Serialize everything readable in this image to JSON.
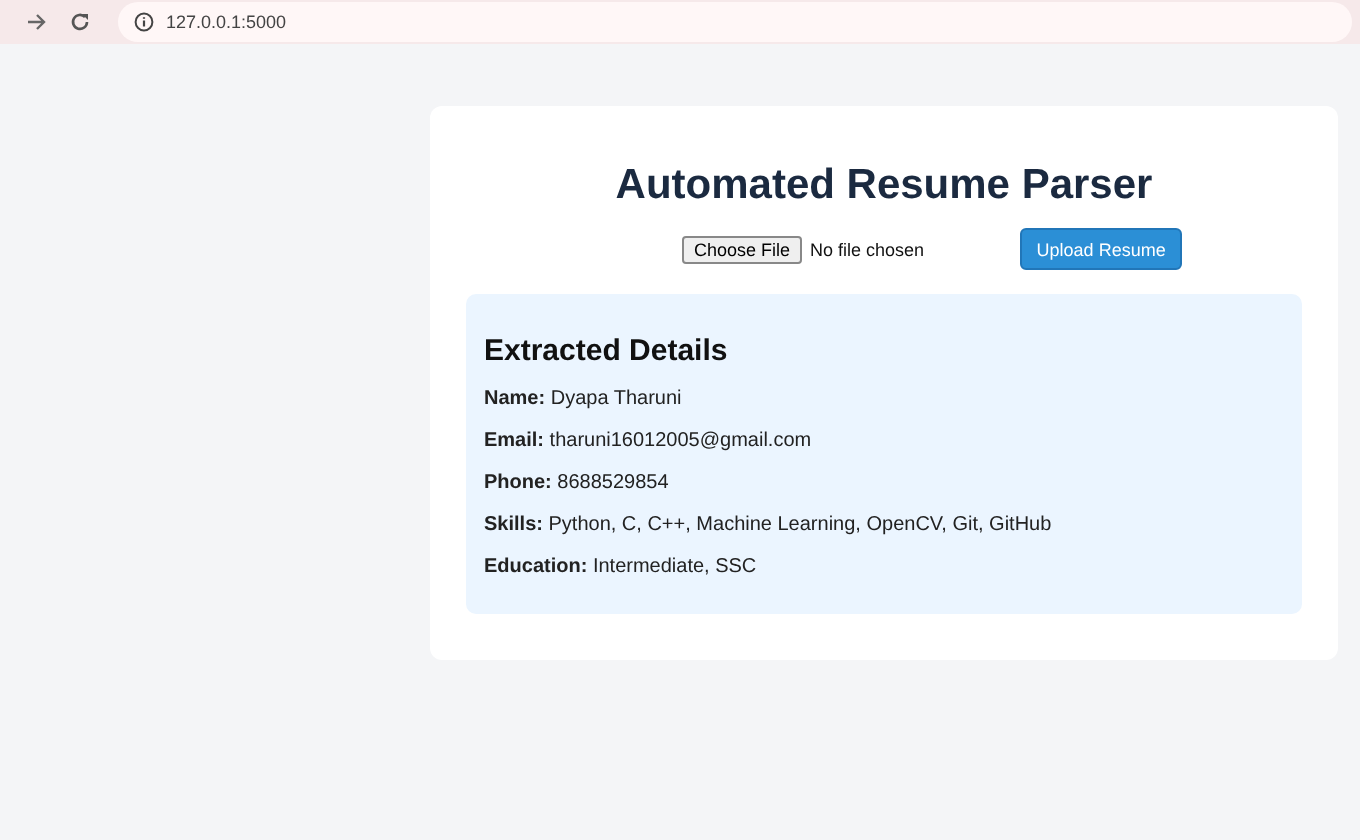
{
  "browser": {
    "address": "127.0.0.1:5000"
  },
  "app": {
    "title": "Automated Resume Parser",
    "file_button": "Choose File",
    "file_status": "No file chosen",
    "upload_button": "Upload Resume"
  },
  "details": {
    "heading": "Extracted Details",
    "fields": [
      {
        "text": "**Name:** Dyapa Tharuni"
      },
      {
        "text": "**Email:** tharuni16012005@gmail.com"
      },
      {
        "text": "**Phone:** 8688529854"
      },
      {
        "text": "**Skills:** Python, C, C++, Machine Learning, OpenCV, Git, GitHub"
      },
      {
        "text": "**Education:** Intermediate, SSC"
      }
    ]
  }
}
